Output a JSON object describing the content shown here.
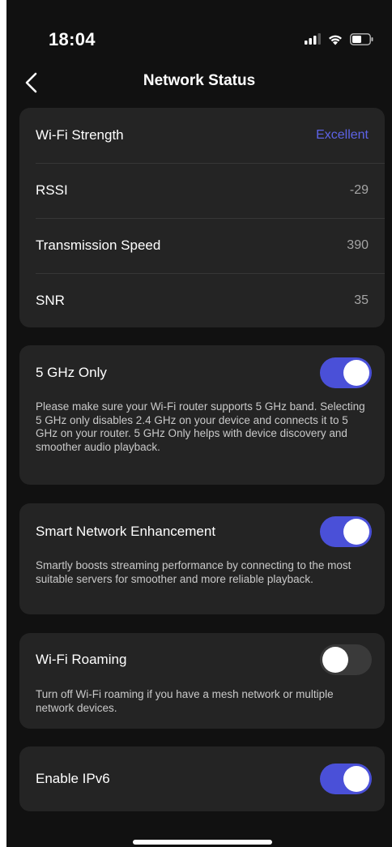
{
  "status_bar": {
    "time": "18:04",
    "icons": [
      "signal-icon",
      "wifi-icon",
      "battery-icon"
    ]
  },
  "nav": {
    "back_icon": "chevron-left-icon",
    "title": "Network Status"
  },
  "stats": [
    {
      "label": "Wi-Fi Strength",
      "value": "Excellent",
      "accent": true
    },
    {
      "label": "RSSI",
      "value": "-29"
    },
    {
      "label": "Transmission Speed",
      "value": "390"
    },
    {
      "label": "SNR",
      "value": "35"
    }
  ],
  "settings": {
    "five_ghz": {
      "label": "5 GHz Only",
      "enabled": true,
      "description": "Please make sure your Wi-Fi router supports 5 GHz band. Selecting 5 GHz only disables 2.4 GHz on your device and connects it to 5 GHz on your router. 5 GHz Only helps with device discovery and smoother audio playback."
    },
    "smart_network": {
      "label": "Smart Network Enhancement",
      "enabled": true,
      "description": "Smartly boosts streaming performance by connecting to the most suitable servers for smoother and more reliable playback."
    },
    "wifi_roaming": {
      "label": "Wi-Fi Roaming",
      "enabled": false,
      "description": "Turn off Wi-Fi roaming if you have a mesh network or multiple network devices."
    },
    "ipv6": {
      "label": "Enable IPv6",
      "enabled": true
    }
  },
  "colors": {
    "background": "#111111",
    "card": "#242424",
    "accent": "#5d63e6",
    "toggle_on": "#4a50d8",
    "toggle_off": "#3a3a3a"
  }
}
